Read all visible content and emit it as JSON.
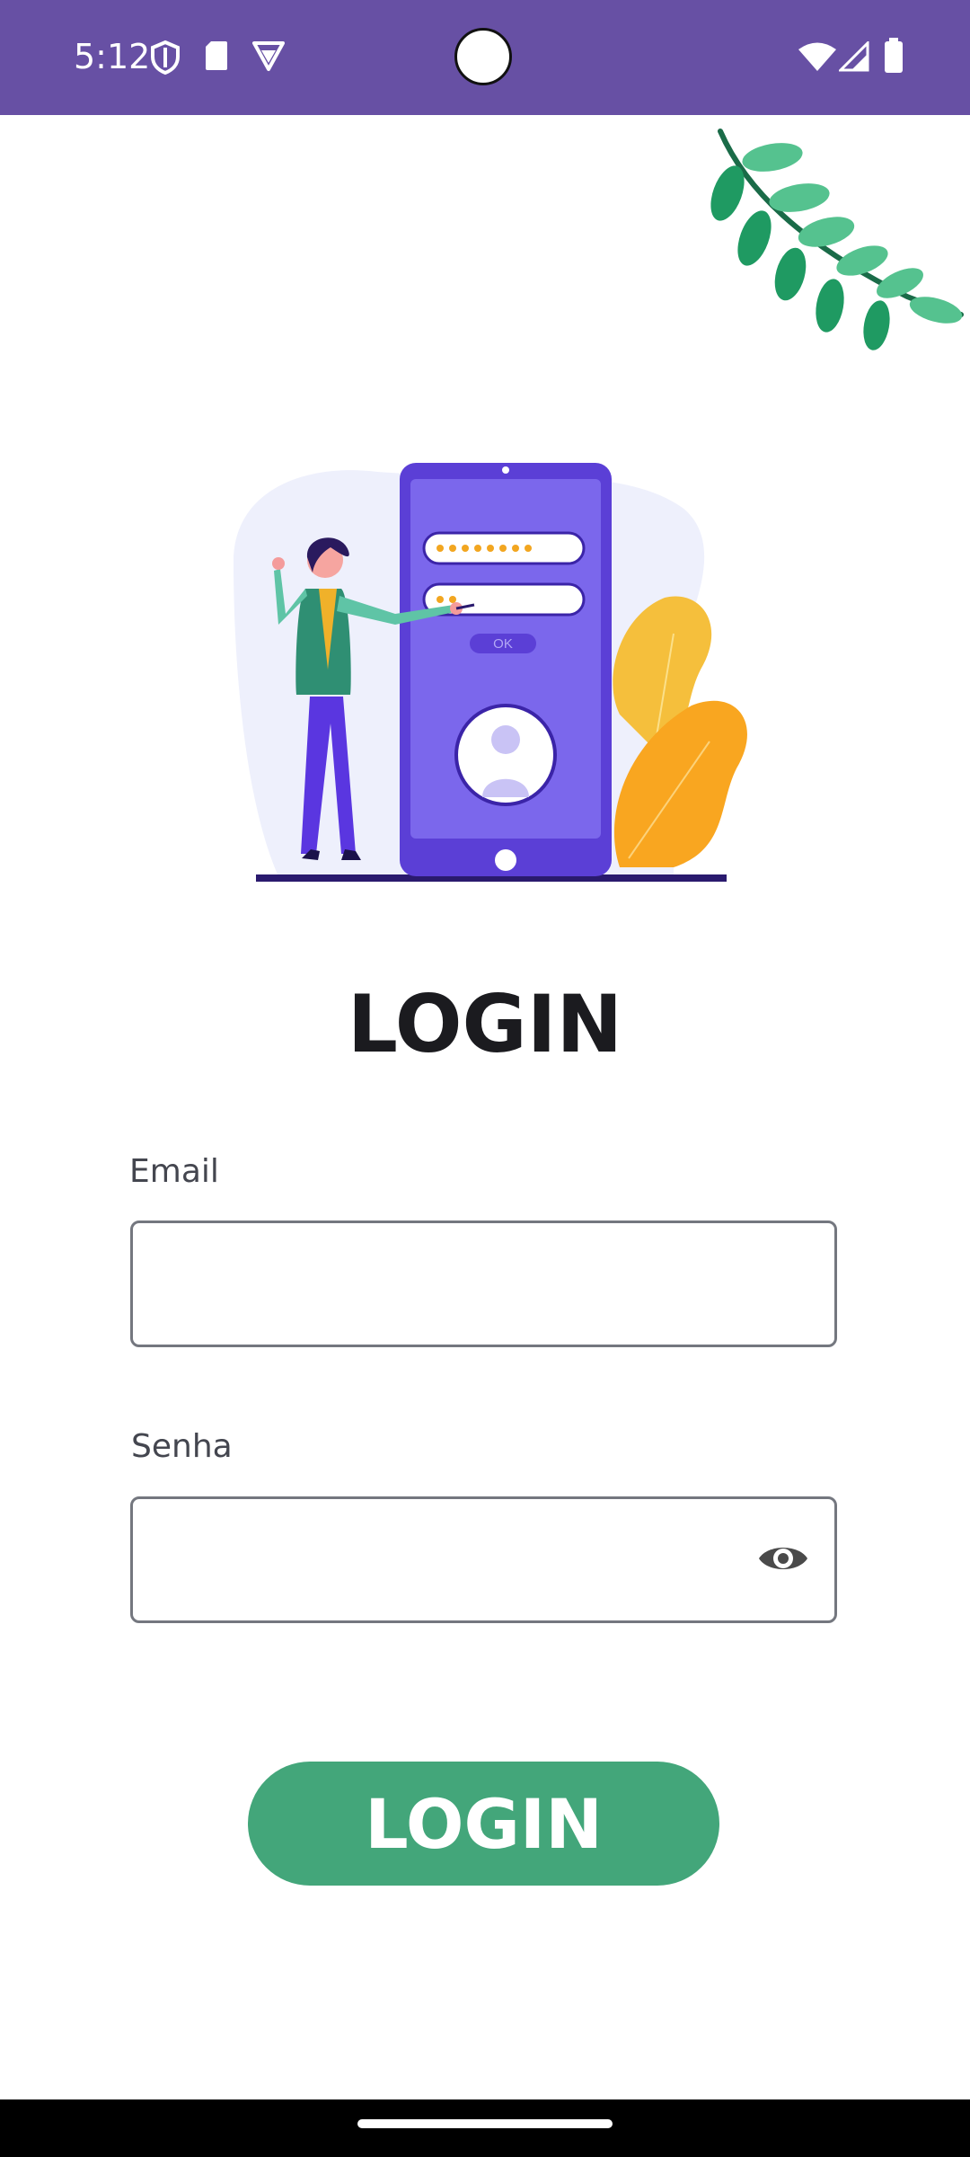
{
  "status_bar": {
    "time": "5:12",
    "left_icons": [
      "shield-icon",
      "sd-card-icon",
      "vpn-icon"
    ],
    "right_icons": [
      "wifi-icon",
      "signal-icon",
      "battery-icon"
    ],
    "background_color": "#6750a4"
  },
  "illustration": {
    "phone_button_label": "OK"
  },
  "page": {
    "title": "LOGIN"
  },
  "email_field": {
    "label": "Email",
    "value": "",
    "placeholder": ""
  },
  "password_field": {
    "label": "Senha",
    "value": "",
    "placeholder": "",
    "toggle_icon": "eye-icon"
  },
  "login_button": {
    "label": "LOGIN",
    "color": "#43a67a"
  }
}
